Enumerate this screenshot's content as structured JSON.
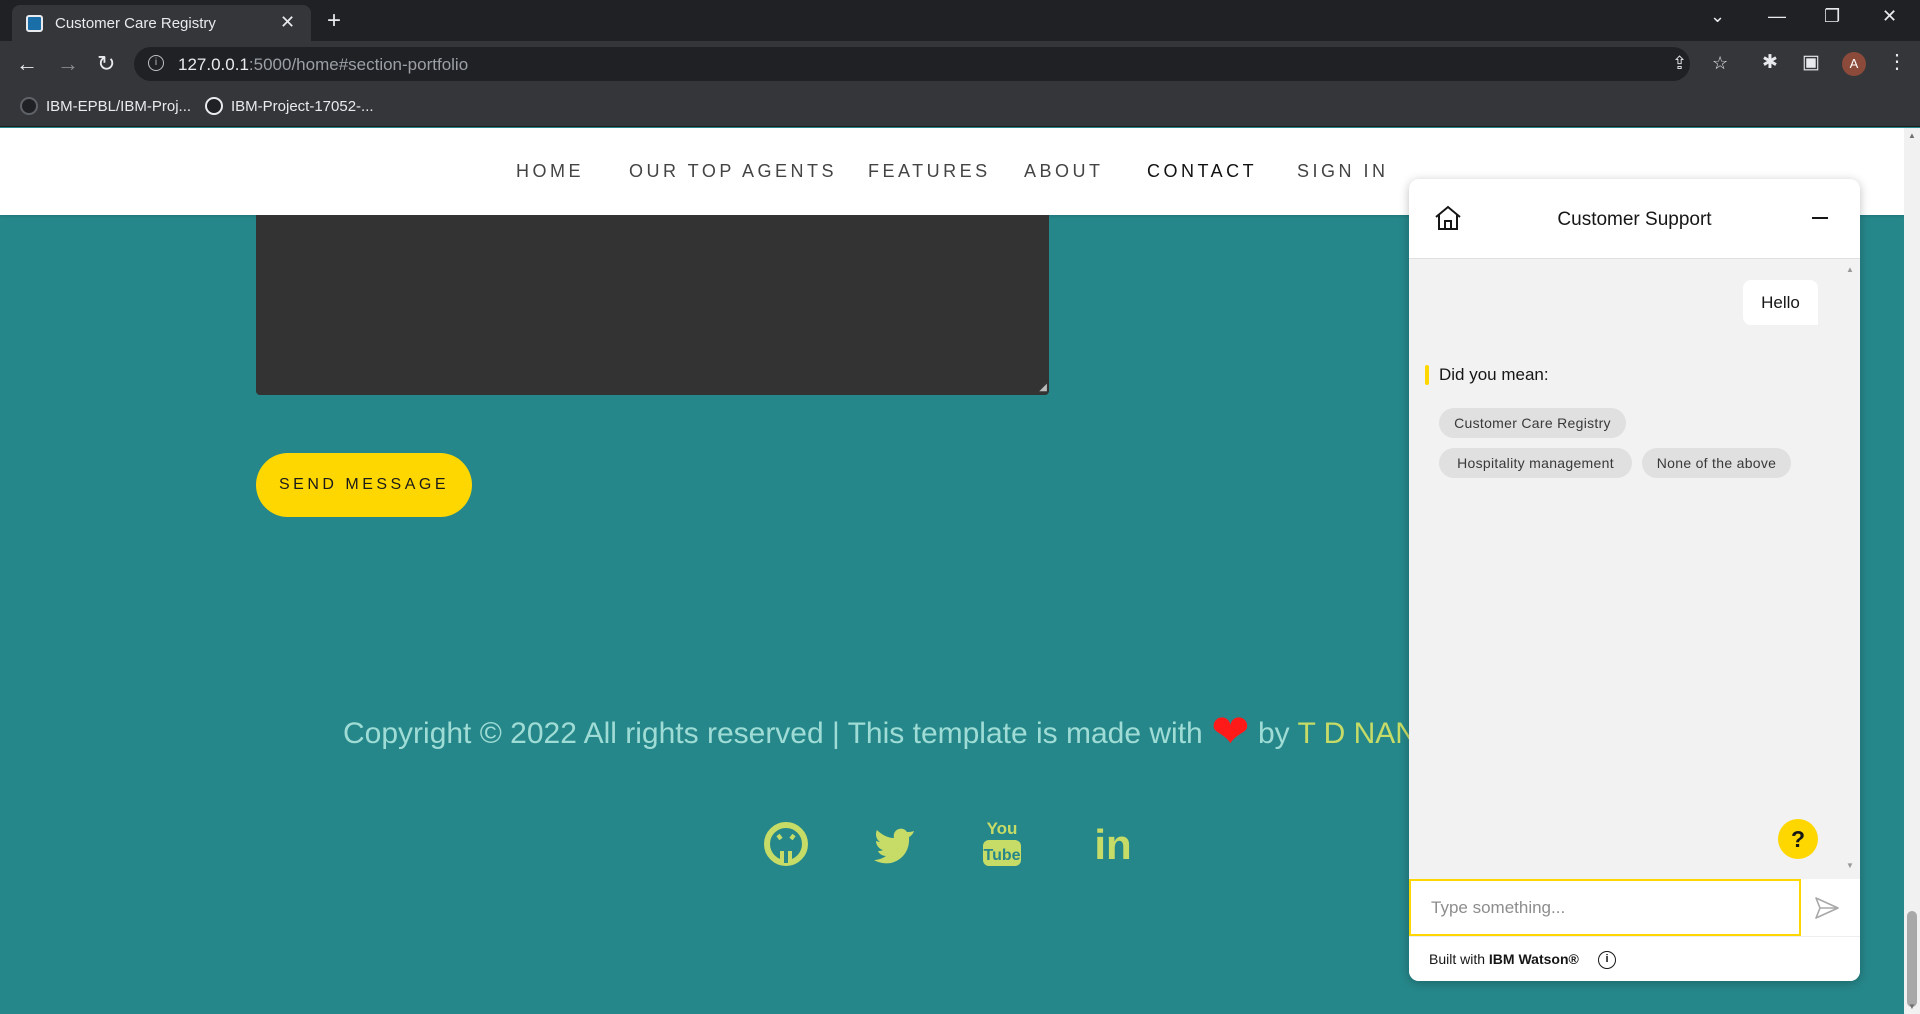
{
  "browser": {
    "tab_title": "Customer Care Registry",
    "url_host": "127.0.0.1",
    "url_path": ":5000/home#section-portfolio",
    "profile_initial": "A",
    "bookmarks": [
      {
        "label": "IBM-EPBL/IBM-Proj..."
      },
      {
        "label": "IBM-Project-17052-..."
      }
    ]
  },
  "site_nav": {
    "items": [
      {
        "label": "HOME"
      },
      {
        "label": "OUR TOP AGENTS"
      },
      {
        "label": "FEATURES"
      },
      {
        "label": "ABOUT"
      },
      {
        "label": "CONTACT"
      },
      {
        "label": "SIGN IN"
      }
    ],
    "active": "CONTACT"
  },
  "contact": {
    "send_label": "SEND MESSAGE"
  },
  "footer": {
    "copyright_prefix": "Copyright © 2022 All rights reserved | This template is made with",
    "heart": "❤",
    "by": "by",
    "author": "T D NAN",
    "social_icons": [
      "github-icon",
      "twitter-icon",
      "youtube-icon",
      "linkedin-icon"
    ],
    "youtube_top": "You",
    "youtube_bottom": "Tube",
    "linkedin_text": "in"
  },
  "chat": {
    "title": "Customer Support",
    "user_message": "Hello",
    "bot_prompt": "Did you mean:",
    "suggestions": [
      {
        "label": "Customer Care Registry"
      },
      {
        "label": "Hospitality management"
      },
      {
        "label": "None of the above"
      }
    ],
    "input_placeholder": "Type something...",
    "help_label": "?",
    "footer_prefix": "Built with",
    "footer_brand": "IBM Watson®"
  },
  "colors": {
    "page_bg": "#26878a",
    "accent_yellow": "#ffd700",
    "social_green": "#c7dc66",
    "textarea_bg": "#333333"
  }
}
